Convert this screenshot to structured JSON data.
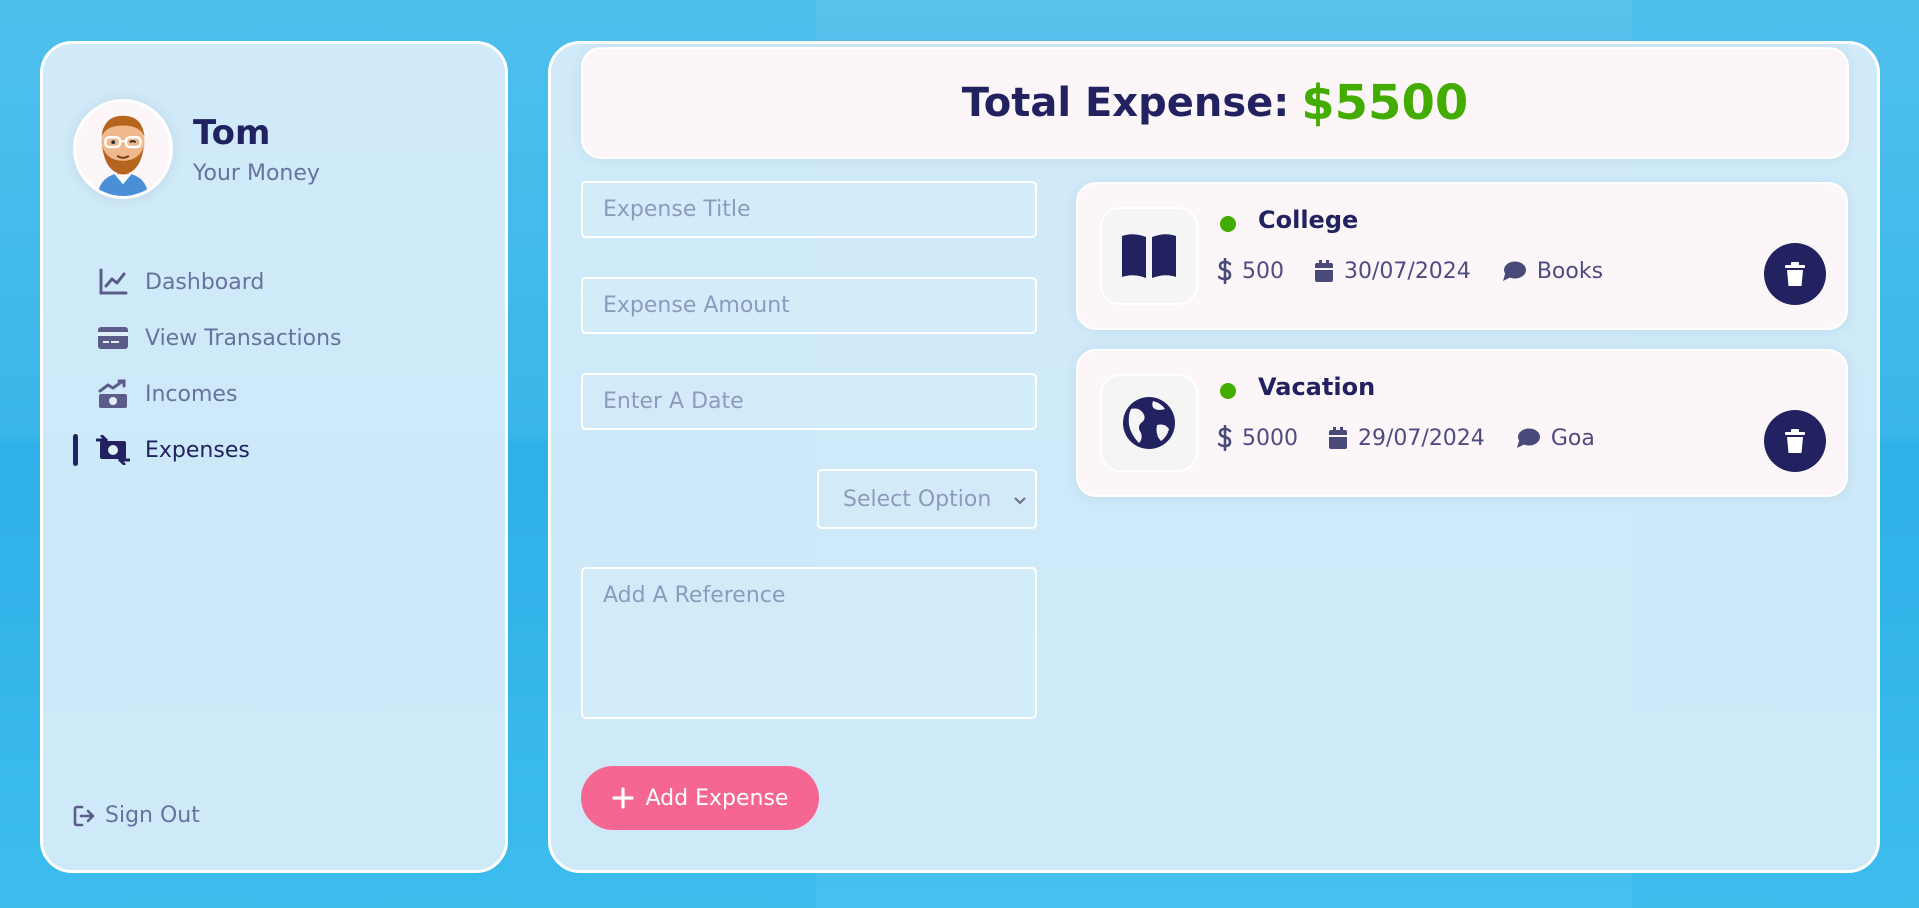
{
  "user": {
    "name": "Tom",
    "subtitle": "Your Money",
    "avatar_icon": "avatar-icon"
  },
  "menu": [
    {
      "label": "Dashboard",
      "icon": "chart-line-icon",
      "active": false
    },
    {
      "label": "View Transactions",
      "icon": "credit-card-icon",
      "active": false
    },
    {
      "label": "Incomes",
      "icon": "money-trend-up-icon",
      "active": false
    },
    {
      "label": "Expenses",
      "icon": "money-transfer-icon",
      "active": true
    }
  ],
  "signout": {
    "label": "Sign Out",
    "icon": "sign-out-icon"
  },
  "total": {
    "label": "Total Expense:",
    "amount": "$5500"
  },
  "form": {
    "title_placeholder": "Expense Title",
    "amount_placeholder": "Expense Amount",
    "date_placeholder": "Enter A Date",
    "select_placeholder": "Select Option",
    "reference_placeholder": "Add A Reference",
    "submit_label": "Add Expense"
  },
  "expenses": [
    {
      "title": "College",
      "amount": "500",
      "date": "30/07/2024",
      "note": "Books",
      "icon": "book-icon"
    },
    {
      "title": "Vacation",
      "amount": "5000",
      "date": "29/07/2024",
      "note": "Goa",
      "icon": "globe-icon"
    }
  ],
  "colors": {
    "primary": "#222260",
    "accent_pink": "#f56692",
    "green": "#42ad00",
    "background_blue": "#3db8ea"
  }
}
